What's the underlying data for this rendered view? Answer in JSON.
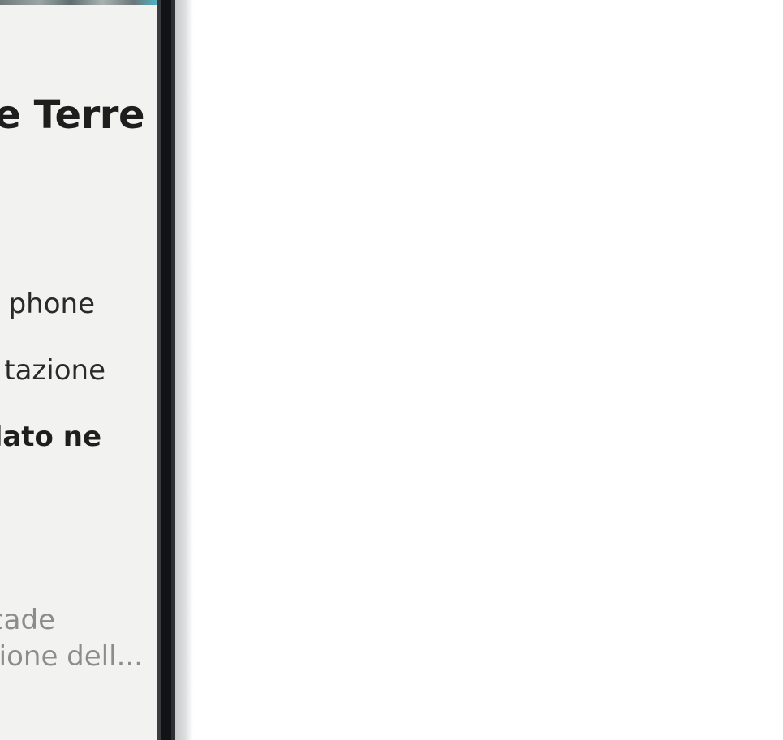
{
  "screen": {
    "title": "ne Terre",
    "lines": [
      "phone",
      "tazione",
      "lato ne"
    ],
    "snippet": [
      "cade",
      "ione dell..."
    ]
  },
  "colors": {
    "screen_background": "#f2f2f1",
    "title_text": "#1e1e1e",
    "body_text": "#2a2a2a",
    "muted_text": "#8c8c8c",
    "bezel": "#111315",
    "page_background": "#ffffff"
  }
}
